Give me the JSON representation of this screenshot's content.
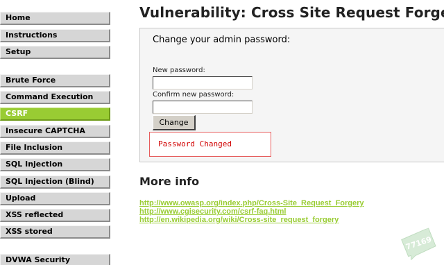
{
  "sidebar": {
    "groups": [
      [
        {
          "label": "Home"
        },
        {
          "label": "Instructions"
        },
        {
          "label": "Setup"
        }
      ],
      [
        {
          "label": "Brute Force"
        },
        {
          "label": "Command Execution"
        },
        {
          "label": "CSRF",
          "selected": true
        },
        {
          "label": "Insecure CAPTCHA"
        },
        {
          "label": "File Inclusion"
        },
        {
          "label": "SQL Injection"
        },
        {
          "label": "SQL Injection (Blind)"
        },
        {
          "label": "Upload"
        },
        {
          "label": "XSS reflected"
        },
        {
          "label": "XSS stored"
        }
      ],
      [
        {
          "label": "DVWA Security"
        }
      ]
    ]
  },
  "main": {
    "title": "Vulnerability: Cross Site Request Forgery (CSRF)",
    "form": {
      "heading": "Change your admin password:",
      "new_password_label": "New password:",
      "new_password_value": "",
      "confirm_password_label": "Confirm new password:",
      "confirm_password_value": "",
      "button_label": "Change",
      "message": "Password Changed"
    },
    "more_info": {
      "heading": "More info",
      "links": [
        "http://www.owasp.org/index.php/Cross-Site_Request_Forgery",
        "http://www.cgisecurity.com/csrf-faq.html",
        "http://en.wikipedia.org/wiki/Cross-site_request_forgery"
      ]
    }
  },
  "watermark": {
    "text": "77169"
  },
  "colors": {
    "accent": "#99cc33",
    "menu_bg": "#d6d6d6",
    "error_text": "#d10000",
    "error_border": "#e65c5c"
  }
}
